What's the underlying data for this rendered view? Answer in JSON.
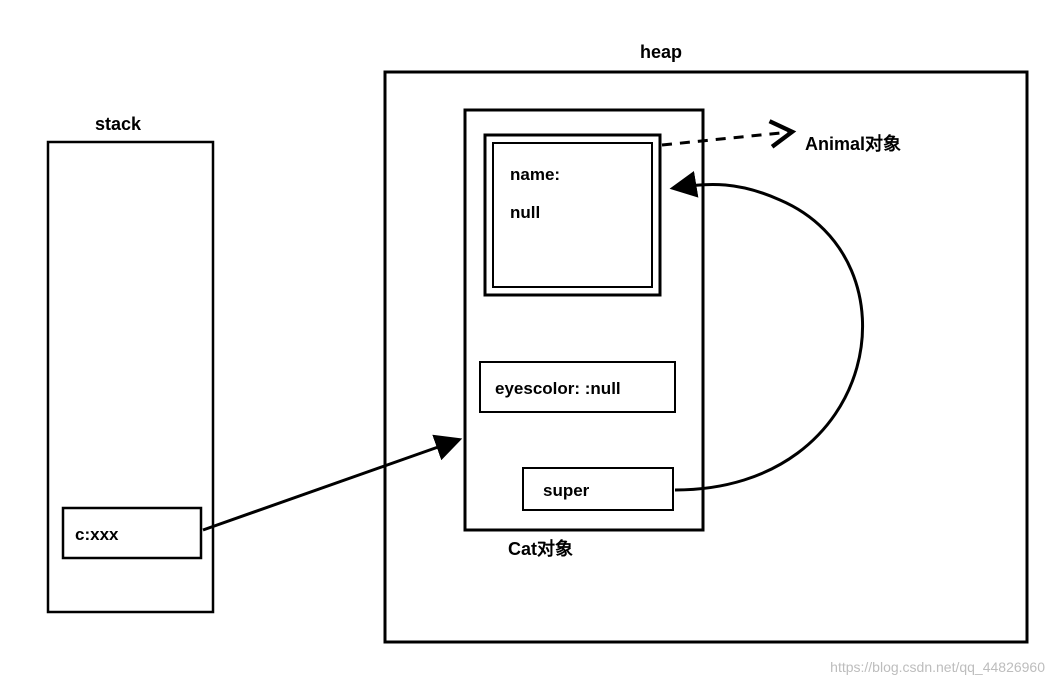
{
  "labels": {
    "stack": "stack",
    "heap": "heap",
    "stack_var": "c:xxx",
    "name_field": "name:",
    "name_value": "null",
    "eyescolor": "eyescolor: :null",
    "super": "super",
    "cat_object": "Cat对象",
    "animal_object": "Animal对象"
  },
  "watermark": "https://blog.csdn.net/qq_44826960"
}
